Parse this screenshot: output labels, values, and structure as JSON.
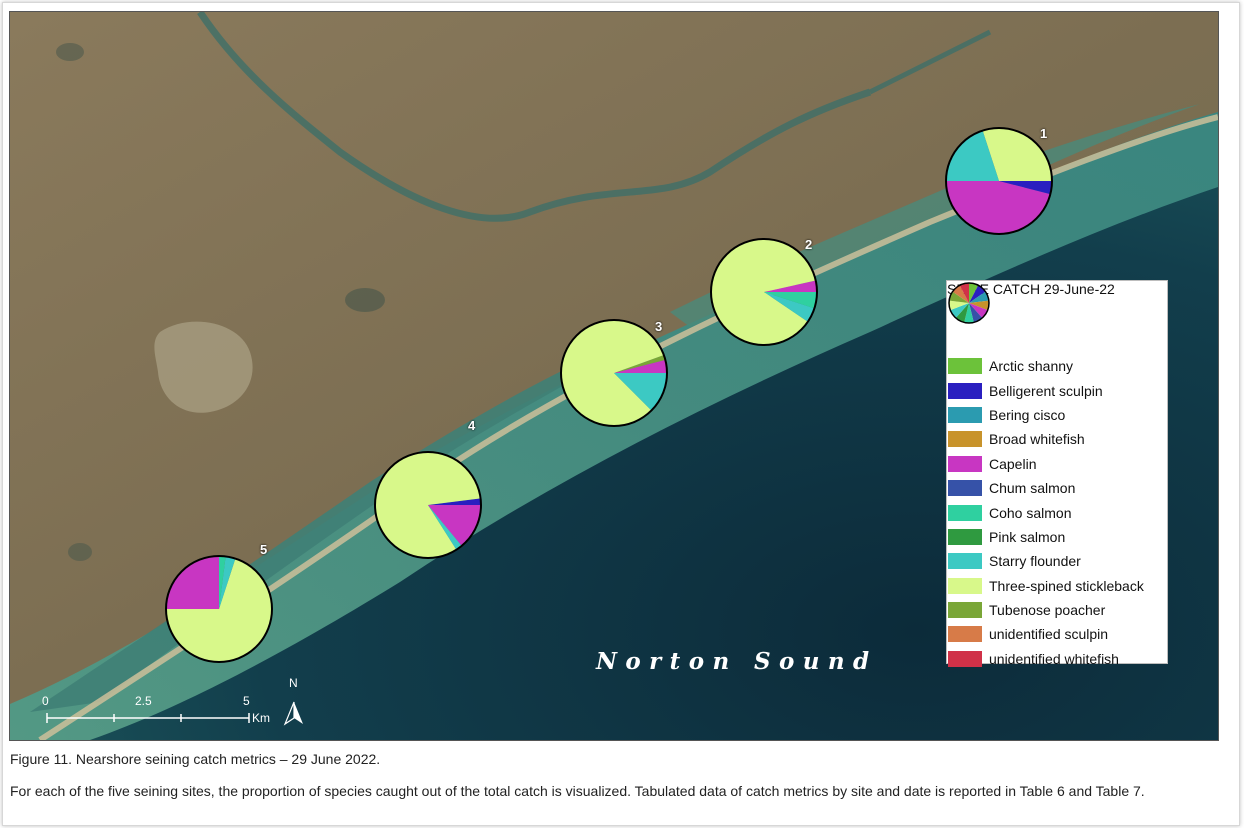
{
  "colors": {
    "arctic_shanny": "#6cc23a",
    "belligerent_sculpin": "#2a1fc0",
    "bering_cisco": "#2b9bb0",
    "broad_whitefish": "#c8932b",
    "capelin": "#c836c2",
    "chum_salmon": "#3652a8",
    "coho_salmon": "#2fd0a0",
    "pink_salmon": "#2f9a40",
    "starry_flounder": "#3cc9c3",
    "three_spined_stickleback": "#d8f88a",
    "tubenose_poacher": "#7aa637",
    "unidentified_sculpin": "#d77b48",
    "unidentified_whitefish": "#d03148"
  },
  "legend": {
    "title": "SEINE CATCH 29-June-22",
    "items": [
      {
        "label": "Arctic shanny",
        "color": "#6cc23a"
      },
      {
        "label": "Belligerent sculpin",
        "color": "#2a1fc0"
      },
      {
        "label": "Bering cisco",
        "color": "#2b9bb0"
      },
      {
        "label": "Broad whitefish",
        "color": "#c8932b"
      },
      {
        "label": "Capelin",
        "color": "#c836c2"
      },
      {
        "label": "Chum salmon",
        "color": "#3652a8"
      },
      {
        "label": "Coho salmon",
        "color": "#2fd0a0"
      },
      {
        "label": "Pink salmon",
        "color": "#2f9a40"
      },
      {
        "label": "Starry flounder",
        "color": "#3cc9c3"
      },
      {
        "label": "Three-spined stickleback",
        "color": "#d8f88a"
      },
      {
        "label": "Tubenose poacher",
        "color": "#7aa637"
      },
      {
        "label": "unidentified sculpin",
        "color": "#d77b48"
      },
      {
        "label": "unidentified whitefish",
        "color": "#d03148"
      }
    ]
  },
  "sites": [
    {
      "label": "1",
      "slices": [
        {
          "species": "Capelin",
          "share": 0.46,
          "color": "#c836c2"
        },
        {
          "species": "Belligerent sculpin",
          "share": 0.04,
          "color": "#2a1fc0"
        },
        {
          "species": "Three-spined stickleback",
          "share": 0.3,
          "color": "#d8f88a"
        },
        {
          "species": "Starry flounder",
          "share": 0.2,
          "color": "#3cc9c3"
        }
      ]
    },
    {
      "label": "2",
      "slices": [
        {
          "species": "Capelin",
          "share": 0.035,
          "color": "#c836c2"
        },
        {
          "species": "Three-spined stickleback",
          "share": 0.87,
          "color": "#d8f88a"
        },
        {
          "species": "Starry flounder",
          "share": 0.045,
          "color": "#3cc9c3"
        },
        {
          "species": "Coho salmon",
          "share": 0.05,
          "color": "#2fd0a0"
        }
      ]
    },
    {
      "label": "3",
      "slices": [
        {
          "species": "Capelin",
          "share": 0.04,
          "color": "#c836c2"
        },
        {
          "species": "Tubenose poacher",
          "share": 0.015,
          "color": "#7aa637"
        },
        {
          "species": "Three-spined stickleback",
          "share": 0.82,
          "color": "#d8f88a"
        },
        {
          "species": "Starry flounder",
          "share": 0.125,
          "color": "#3cc9c3"
        }
      ]
    },
    {
      "label": "4",
      "slices": [
        {
          "species": "Belligerent sculpin",
          "share": 0.02,
          "color": "#2a1fc0"
        },
        {
          "species": "Three-spined stickleback",
          "share": 0.82,
          "color": "#d8f88a"
        },
        {
          "species": "Starry flounder",
          "share": 0.02,
          "color": "#3cc9c3"
        },
        {
          "species": "Capelin",
          "share": 0.14,
          "color": "#c836c2"
        }
      ]
    },
    {
      "label": "5",
      "slices": [
        {
          "species": "Capelin",
          "share": 0.25,
          "color": "#c836c2"
        },
        {
          "species": "Three-spined stickleback",
          "share": 0.7,
          "color": "#d8f88a"
        },
        {
          "species": "Starry flounder",
          "share": 0.03,
          "color": "#3cc9c3"
        },
        {
          "species": "Coho salmon",
          "share": 0.02,
          "color": "#2fd0a0"
        }
      ]
    }
  ],
  "sea_label": "Norton Sound",
  "scale_bar": {
    "ticks": [
      "0",
      "2.5",
      "5"
    ],
    "unit": "Km"
  },
  "north_arrow": "N",
  "caption": {
    "title": "Figure 11. Nearshore seining catch metrics – 29 June 2022.",
    "body": "For each of the five seining sites, the proportion of species caught out of the total catch is visualized. Tabulated data of catch metrics by site and date is reported in Table 6 and Table 7."
  }
}
